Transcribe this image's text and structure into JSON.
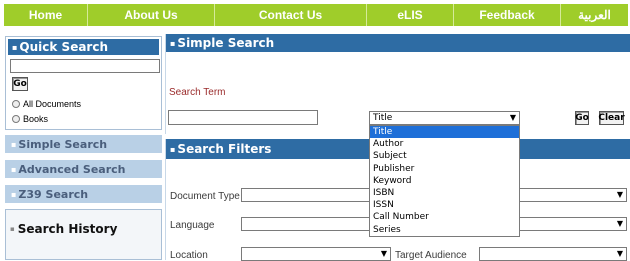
{
  "nav": {
    "items": [
      "Home",
      "About Us",
      "Contact Us",
      "eLIS",
      "Feedback",
      "العربية"
    ]
  },
  "quick_search": {
    "title": "Quick Search",
    "go": "Go",
    "options": [
      "All Documents",
      "Books"
    ]
  },
  "sidebar": {
    "items": [
      "Simple Search",
      "Advanced Search",
      "Z39 Search"
    ],
    "history_title": "Search History"
  },
  "simple_search": {
    "title": "Simple Search",
    "term_label": "Search Term",
    "field_selected": "Title",
    "field_options": [
      "Title",
      "Author",
      "Subject",
      "Publisher",
      "Keyword",
      "ISBN",
      "ISSN",
      "Call Number",
      "Series"
    ],
    "go": "Go",
    "clear": "Clear"
  },
  "filters": {
    "title": "Search Filters",
    "document_type": "Document Type",
    "language": "Language",
    "location": "Location",
    "target_audience": "Target Audience"
  },
  "colors": {
    "nav": "#9fcd2a",
    "header": "#2e6ca4",
    "side_item": "#b9d0e6",
    "selected_option": "#1e6fd8"
  }
}
